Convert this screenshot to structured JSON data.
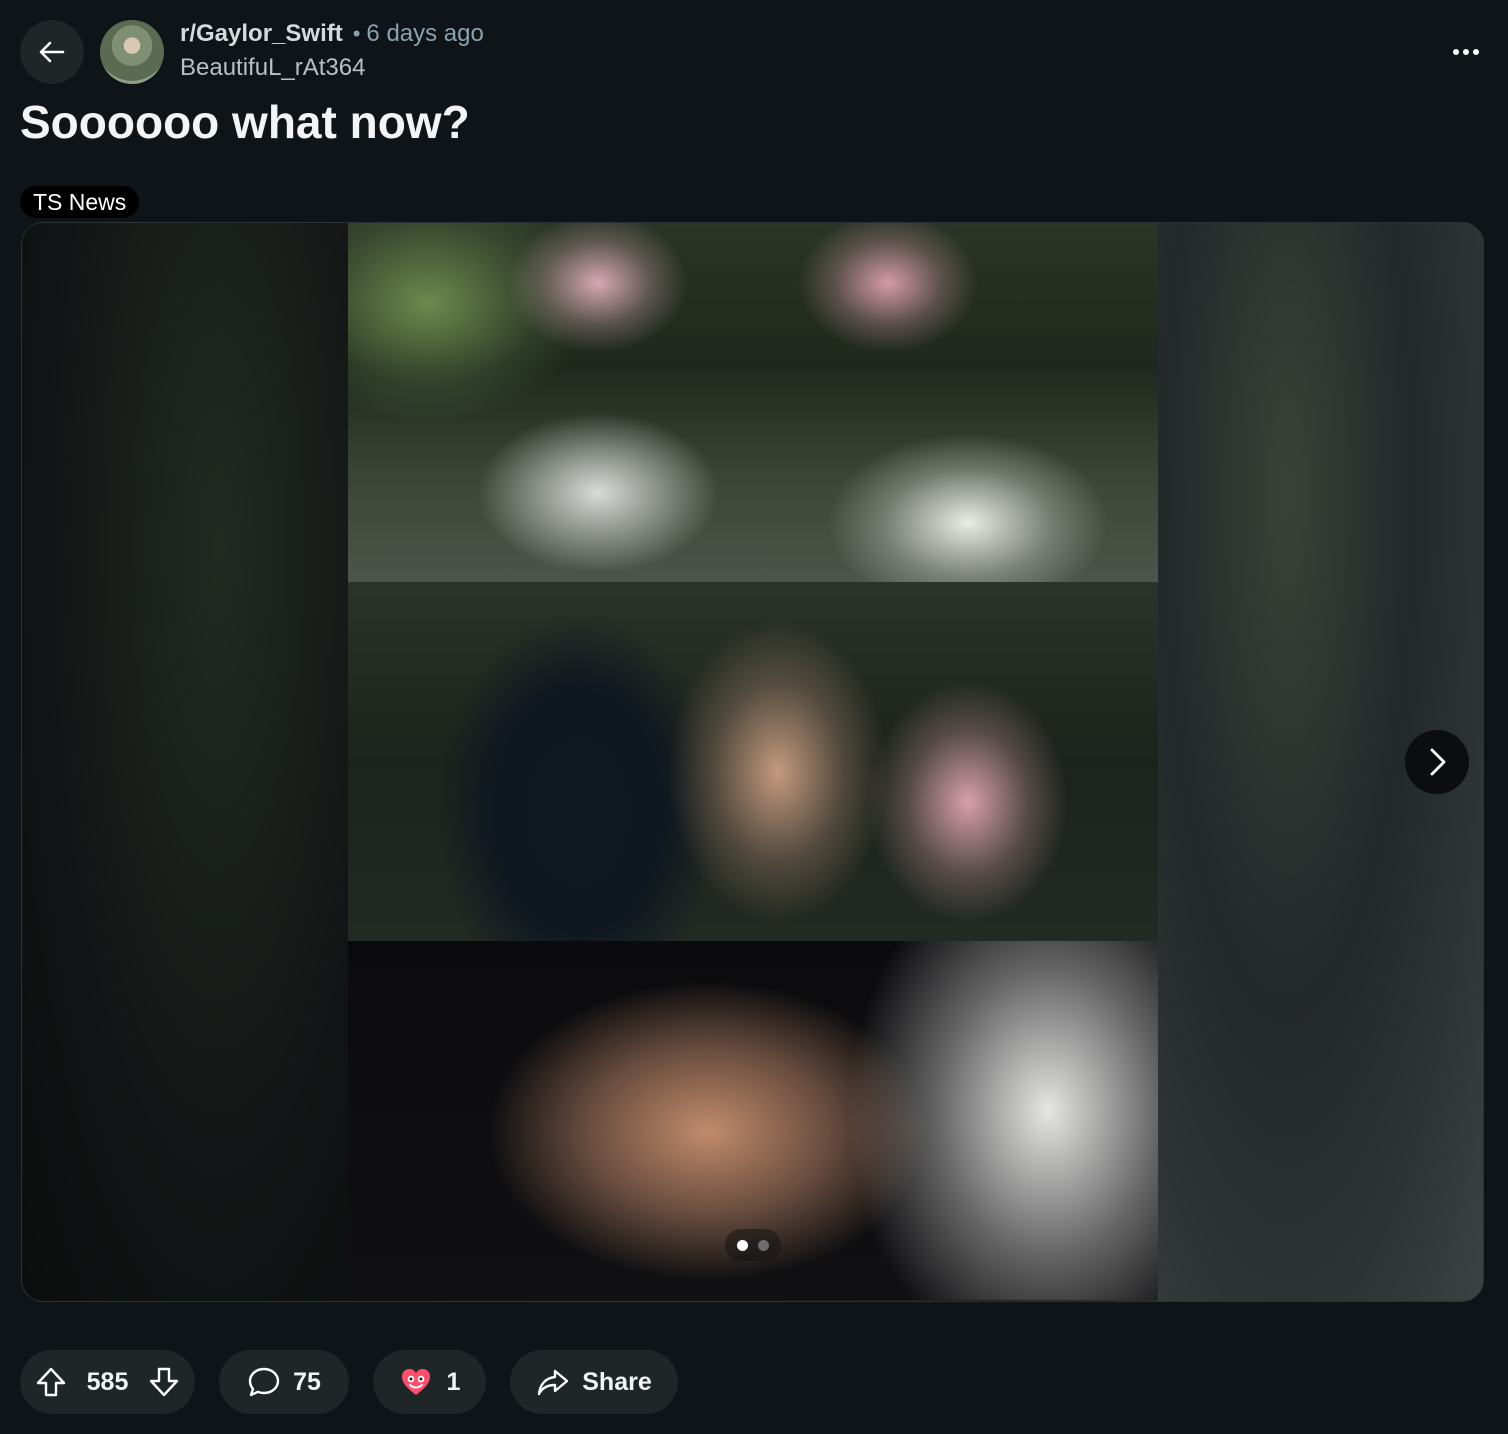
{
  "header": {
    "subreddit": "r/Gaylor_Swift",
    "separator": "•",
    "time_ago": "6 days ago",
    "author": "BeautifuL_rAt364"
  },
  "post": {
    "title": "Soooooo what now?",
    "flair": "TS News"
  },
  "media": {
    "total_slides": 2,
    "current_slide": 1
  },
  "actions": {
    "upvotes": "585",
    "comments": "75",
    "awards": "1",
    "share_label": "Share"
  },
  "colors": {
    "background": "#0e1417",
    "pill": "#1f2628",
    "flair_bg": "#000000",
    "text": "#f2f4f5",
    "muted": "#8ba2ad"
  },
  "icons": {
    "back": "arrow-left-icon",
    "more": "more-horizontal-icon",
    "next": "chevron-right-icon",
    "upvote": "upvote-icon",
    "downvote": "downvote-icon",
    "comment": "comment-icon",
    "award": "award-icon",
    "share": "share-icon"
  }
}
